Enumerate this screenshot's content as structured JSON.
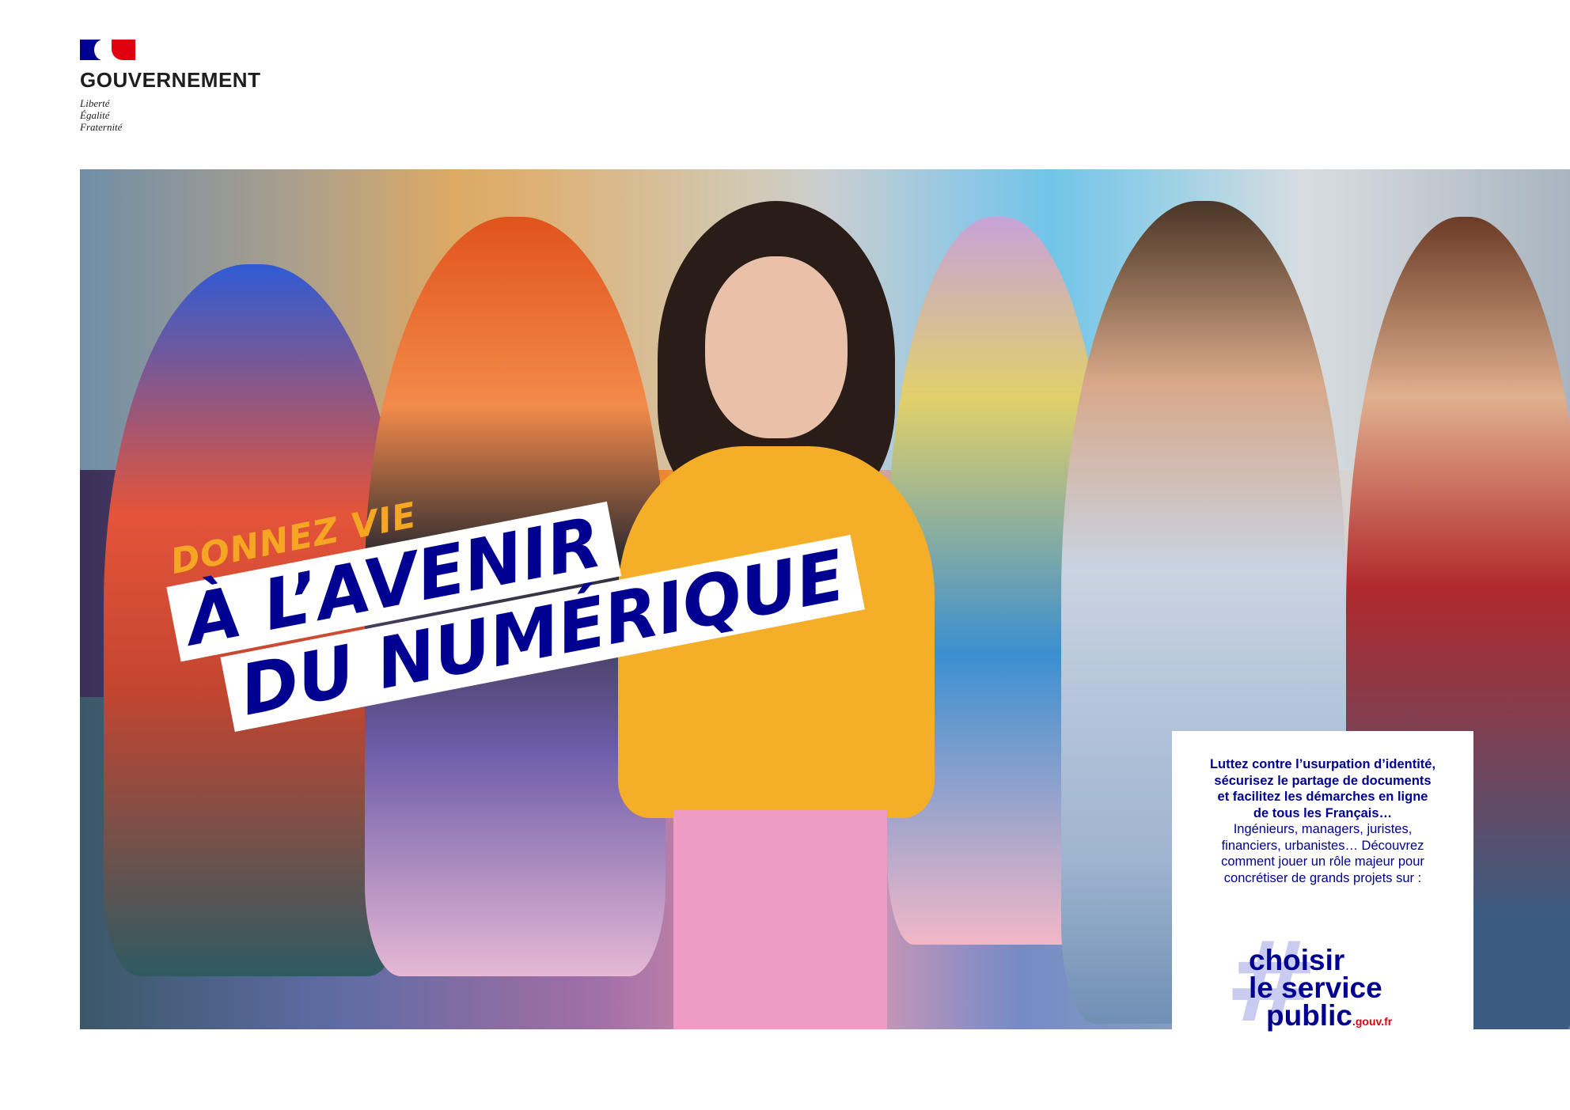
{
  "logo": {
    "title": "GOUVERNEMENT",
    "motto": [
      "Liberté",
      "Égalité",
      "Fraternité"
    ]
  },
  "headline": {
    "line1": "DONNEZ VIE",
    "line2": "À L’AVENIR",
    "line3": "DU NUMÉRIQUE"
  },
  "info": {
    "lead": [
      "Luttez contre l’usurpation d’identité,",
      "sécurisez le partage de documents",
      "et facilitez les démarches en ligne",
      "de tous les Français…"
    ],
    "desc": [
      "Ingénieurs, managers, juristes,",
      "financiers, urbanistes… Découvrez",
      "comment jouer un rôle majeur pour",
      "concrétiser de grands projets sur :"
    ],
    "brand": {
      "hash": "#",
      "line1": "choisir",
      "line2": "le service",
      "line3": "public",
      "domain": ".gouv.fr"
    }
  },
  "colors": {
    "navy": "#000091",
    "red": "#e1000f",
    "accent": "#f5a623"
  }
}
